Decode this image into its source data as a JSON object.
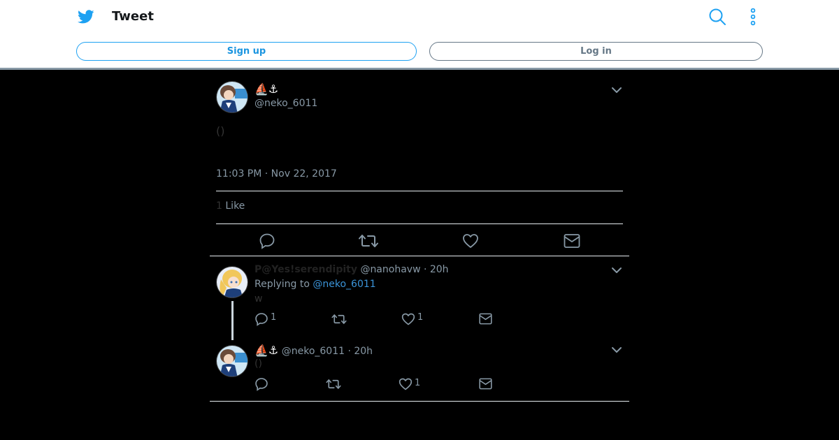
{
  "header": {
    "title": "Tweet",
    "signup_label": "Sign up",
    "login_label": "Log in"
  },
  "main_tweet": {
    "name_emoji": "⛵⚓",
    "handle": "@neko_6011",
    "text": "()",
    "timestamp": "11:03 PM · Nov 22, 2017",
    "like_count": "1",
    "like_label": "Like"
  },
  "replies": [
    {
      "name": "P@Yes!serendipity",
      "handle": "@nanohavw",
      "time": "· 20h",
      "replying_prefix": "Replying to",
      "replying_to": "@neko_6011",
      "text": "w",
      "reply_count": "1",
      "like_count": "1"
    },
    {
      "name_emoji": "⛵⚓",
      "handle": "@neko_6011",
      "time": "· 20h",
      "text": "()",
      "like_count": "1"
    }
  ],
  "colors": {
    "accent": "#1da1f2",
    "link": "#3b94d9",
    "muted": "#8899a6",
    "background": "#000000"
  }
}
